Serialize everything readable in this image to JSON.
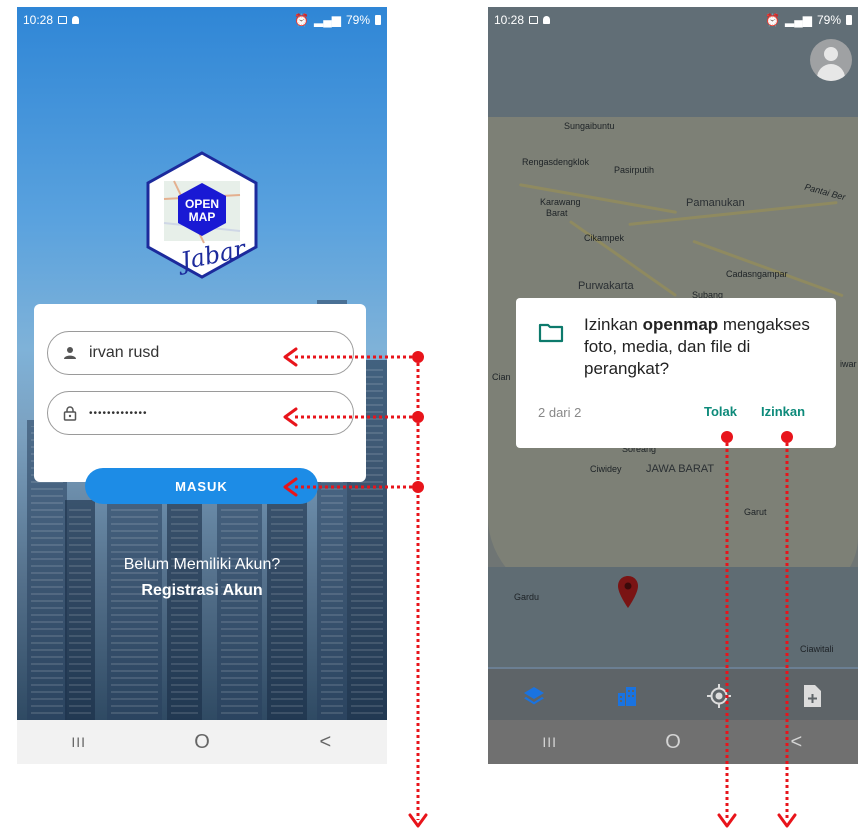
{
  "left_screen": {
    "status": {
      "time": "10:28",
      "battery": "79%"
    },
    "login": {
      "username_value": "irvan rusd",
      "password_value": "•••••••••••••",
      "submit_label": "MASUK",
      "register_question": "Belum Memiliki Akun?",
      "register_link": "Registrasi Akun"
    },
    "logo": {
      "line1": "OPEN",
      "line2": "MAP",
      "script": "Jabar"
    },
    "nav": {
      "recent": "III",
      "home": "O",
      "back": "<"
    }
  },
  "right_screen": {
    "status": {
      "time": "10:28",
      "battery": "79%"
    },
    "map_labels": {
      "sungaibuntu": "Sungaibuntu",
      "rengasdengklok": "Rengasdengklok",
      "pasirputih": "Pasirputih",
      "karawang": "Karawang",
      "barat": "Barat",
      "pamanukan": "Pamanukan",
      "cikampek": "Cikampek",
      "cadasngampar": "Cadasngampar",
      "purwakarta": "Purwakarta",
      "subang": "Subang",
      "ciwidey": "Ciwidey",
      "jawa_barat": "JAWA BARAT",
      "garut": "Garut",
      "gardu": "Gardu",
      "ciawitali": "Ciawitali",
      "soreang": "Soreang",
      "cian": "Cian",
      "iwar": "iwar",
      "pantai": "Pantai Ber"
    },
    "dialog": {
      "text_prefix": "Izinkan ",
      "app_name": "openmap",
      "text_suffix": " mengakses foto, media, dan file di perangkat?",
      "counter": "2 dari 2",
      "deny_label": "Tolak",
      "allow_label": "Izinkan"
    },
    "nav": {
      "recent": "III",
      "home": "O",
      "back": "<"
    }
  },
  "colors": {
    "annotation": "#e8141b",
    "primary_button": "#1d8ce6",
    "dialog_button": "#0d8a7a"
  },
  "icons": [
    "user-icon",
    "lock-icon",
    "folder-icon",
    "layers-icon",
    "buildings-icon",
    "gps-icon",
    "add-file-icon",
    "map-pin-icon",
    "avatar-icon",
    "image-icon",
    "alarm-icon"
  ]
}
